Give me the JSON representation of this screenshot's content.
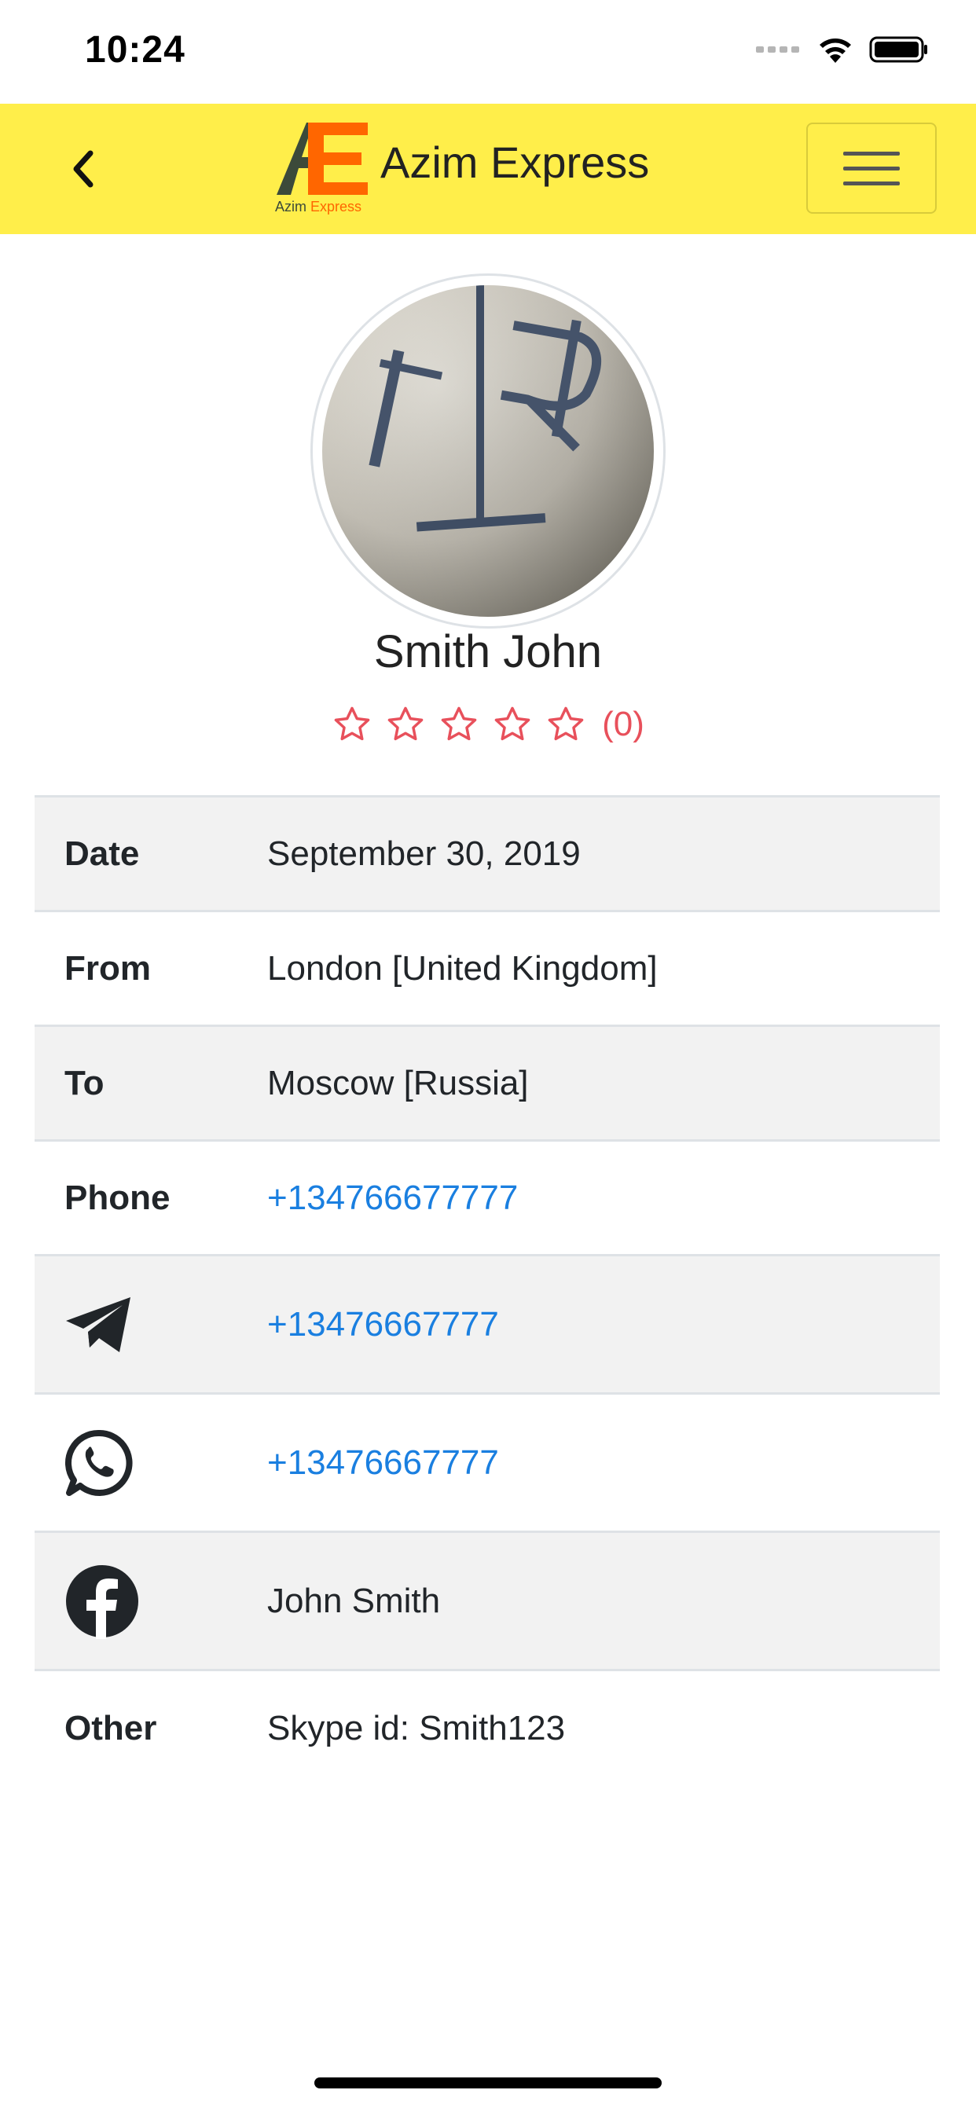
{
  "status_bar": {
    "time": "10:24"
  },
  "header": {
    "brand_name": "Azim Express",
    "logo_caption_part1": "Azim",
    "logo_caption_part2": "Express",
    "accent_color": "#ffee4a",
    "logo_dark_color": "#3c4a3a",
    "logo_orange_color": "#ff6600"
  },
  "profile": {
    "name": "Smith John",
    "rating": {
      "stars_filled": 0,
      "stars_total": 5,
      "count_text": "(0)",
      "color": "#e8505b"
    }
  },
  "details": {
    "date_label": "Date",
    "date_value": "September 30, 2019",
    "from_label": "From",
    "from_value": "London [United Kingdom]",
    "to_label": "To",
    "to_value": "Moscow [Russia]",
    "phone_label": "Phone",
    "phone_value": "+134766677777",
    "telegram_icon": "telegram-icon",
    "telegram_value": "+13476667777",
    "whatsapp_icon": "whatsapp-icon",
    "whatsapp_value": "+13476667777",
    "facebook_icon": "facebook-icon",
    "facebook_value": "John Smith",
    "other_label": "Other",
    "other_value": "Skype id: Smith123",
    "link_color": "#1a7fe0"
  }
}
